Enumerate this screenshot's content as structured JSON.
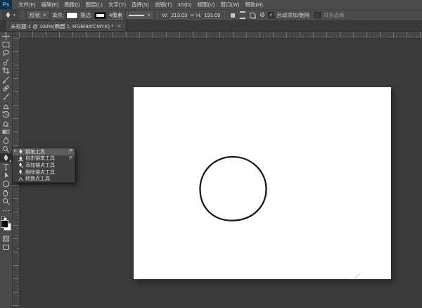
{
  "app": {
    "logo_text": "Ps"
  },
  "menubar": {
    "items": [
      "文件(F)",
      "编辑(E)",
      "图像(I)",
      "图层(L)",
      "文字(Y)",
      "选择(S)",
      "滤镜(T)",
      "3D(D)",
      "视图(V)",
      "窗口(W)",
      "帮助(H)"
    ]
  },
  "options_bar": {
    "mode": "形状",
    "fill_label": "填充:",
    "stroke_label": "描边:",
    "stroke_width": "4像素",
    "w_label": "W:",
    "w_value": "213.03",
    "link_icon": "link-width-height",
    "h_label": "H:",
    "h_value": "191.09",
    "auto_add_delete": "自动添加/删除",
    "auto_add_delete_checked": true,
    "align_edges": "对齐边缘",
    "align_edges_checked": false
  },
  "document_tab": {
    "title": "未标题-1 @ 100%(椭圆 1, RGB/8#/CMYK) *",
    "close": "×"
  },
  "toolbar": {
    "selected_tool": "pen",
    "tools": [
      "move",
      "rectangular-marquee",
      "lasso",
      "quick-selection",
      "crop",
      "eyedropper",
      "spot-healing-brush",
      "brush",
      "clone-stamp",
      "history-brush",
      "eraser",
      "gradient",
      "blur",
      "dodge",
      "pen",
      "type",
      "path-selection",
      "ellipse-shape",
      "hand",
      "zoom",
      "edit-toolbar"
    ],
    "foreground_color": "#050505",
    "background_color": "#ffffff"
  },
  "tool_flyout": {
    "items": [
      {
        "label": "钢笔工具",
        "shortcut": "P",
        "selected": true
      },
      {
        "label": "自由钢笔工具",
        "shortcut": "P",
        "selected": false
      },
      {
        "label": "添加锚点工具",
        "shortcut": "",
        "selected": false
      },
      {
        "label": "删除锚点工具",
        "shortcut": "",
        "selected": false
      },
      {
        "label": "转换点工具",
        "shortcut": "",
        "selected": false
      }
    ]
  },
  "canvas": {
    "shape": "hand-drawn ellipse outline",
    "shape_stroke_color": "#1a1a1a",
    "canvas_color": "#ffffff",
    "pasteboard_color": "#3a3a3a"
  }
}
